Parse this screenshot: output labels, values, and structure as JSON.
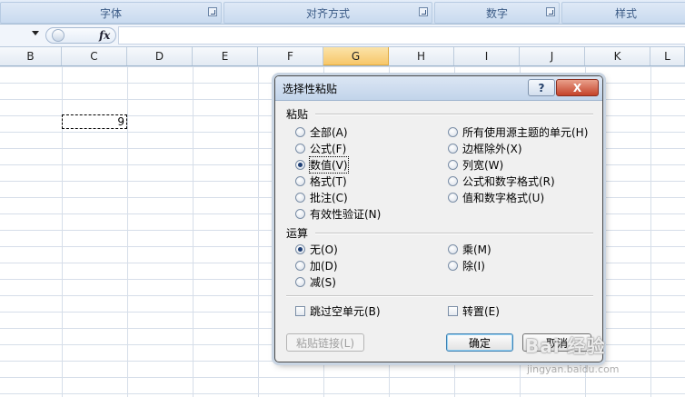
{
  "ribbon": {
    "groups": [
      {
        "label": "字体"
      },
      {
        "label": "对齐方式"
      },
      {
        "label": "数字"
      },
      {
        "label": "样式"
      }
    ]
  },
  "formula_bar": {
    "fx": "fx",
    "value": ""
  },
  "columns": [
    "B",
    "C",
    "D",
    "E",
    "F",
    "G",
    "H",
    "I",
    "J",
    "K",
    "L"
  ],
  "selected_column": "G",
  "cells": {
    "c_value": "9"
  },
  "dialog": {
    "title": "选择性粘贴",
    "help": "?",
    "close": "X",
    "paste_section": "粘贴",
    "paste_left": [
      {
        "label": "全部(A)",
        "checked": false
      },
      {
        "label": "公式(F)",
        "checked": false
      },
      {
        "label": "数值(V)",
        "checked": true
      },
      {
        "label": "格式(T)",
        "checked": false
      },
      {
        "label": "批注(C)",
        "checked": false
      },
      {
        "label": "有效性验证(N)",
        "checked": false
      }
    ],
    "paste_right": [
      {
        "label": "所有使用源主题的单元(H)",
        "checked": false
      },
      {
        "label": "边框除外(X)",
        "checked": false
      },
      {
        "label": "列宽(W)",
        "checked": false
      },
      {
        "label": "公式和数字格式(R)",
        "checked": false
      },
      {
        "label": "值和数字格式(U)",
        "checked": false
      }
    ],
    "operation_section": "运算",
    "op_left": [
      {
        "label": "无(O)",
        "checked": true
      },
      {
        "label": "加(D)",
        "checked": false
      },
      {
        "label": "减(S)",
        "checked": false
      }
    ],
    "op_right": [
      {
        "label": "乘(M)",
        "checked": false
      },
      {
        "label": "除(I)",
        "checked": false
      }
    ],
    "skip_blanks": "跳过空单元(B)",
    "transpose": "转置(E)",
    "paste_link": "粘贴链接(L)",
    "ok": "确定",
    "cancel": "取消"
  },
  "watermark": {
    "text": "Bai 经验",
    "sub": "jingyan.baidu.com"
  }
}
